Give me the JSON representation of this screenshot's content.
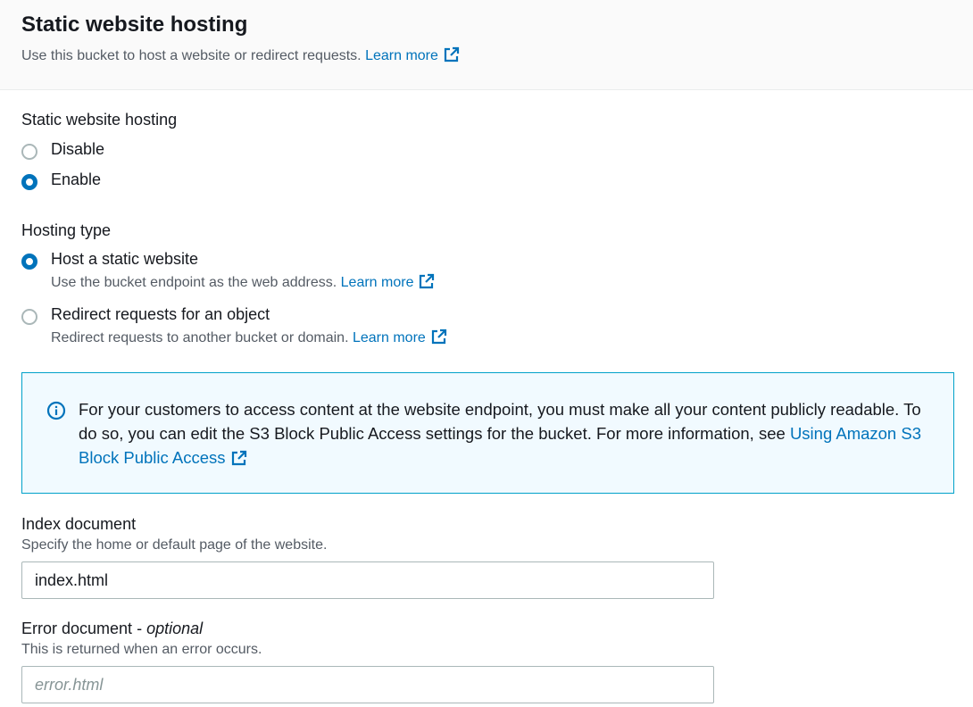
{
  "header": {
    "title": "Static website hosting",
    "description": "Use this bucket to host a website or redirect requests.",
    "learn_more": "Learn more"
  },
  "hosting": {
    "label": "Static website hosting",
    "options": [
      {
        "label": "Disable",
        "selected": false
      },
      {
        "label": "Enable",
        "selected": true
      }
    ]
  },
  "hosting_type": {
    "label": "Hosting type",
    "options": [
      {
        "label": "Host a static website",
        "description": "Use the bucket endpoint as the web address.",
        "learn_more": "Learn more",
        "selected": true
      },
      {
        "label": "Redirect requests for an object",
        "description": "Redirect requests to another bucket or domain.",
        "learn_more": "Learn more",
        "selected": false
      }
    ]
  },
  "info": {
    "icon": "info-icon",
    "text": "For your customers to access content at the website endpoint, you must make all your content publicly readable. To do so, you can edit the S3 Block Public Access settings for the bucket. For more information, see",
    "link": "Using Amazon S3 Block Public Access"
  },
  "index_document": {
    "label": "Index document",
    "hint": "Specify the home or default page of the website.",
    "value": "index.html"
  },
  "error_document": {
    "label": "Error document",
    "optional": "optional",
    "hint": "This is returned when an error occurs.",
    "placeholder": "error.html",
    "value": ""
  },
  "colors": {
    "link": "#0073bb",
    "radio_selected": "#0073bb",
    "info_background": "#f1faff",
    "info_border": "#00a1c9",
    "text": "#16191f",
    "secondary_text": "#545b64"
  }
}
